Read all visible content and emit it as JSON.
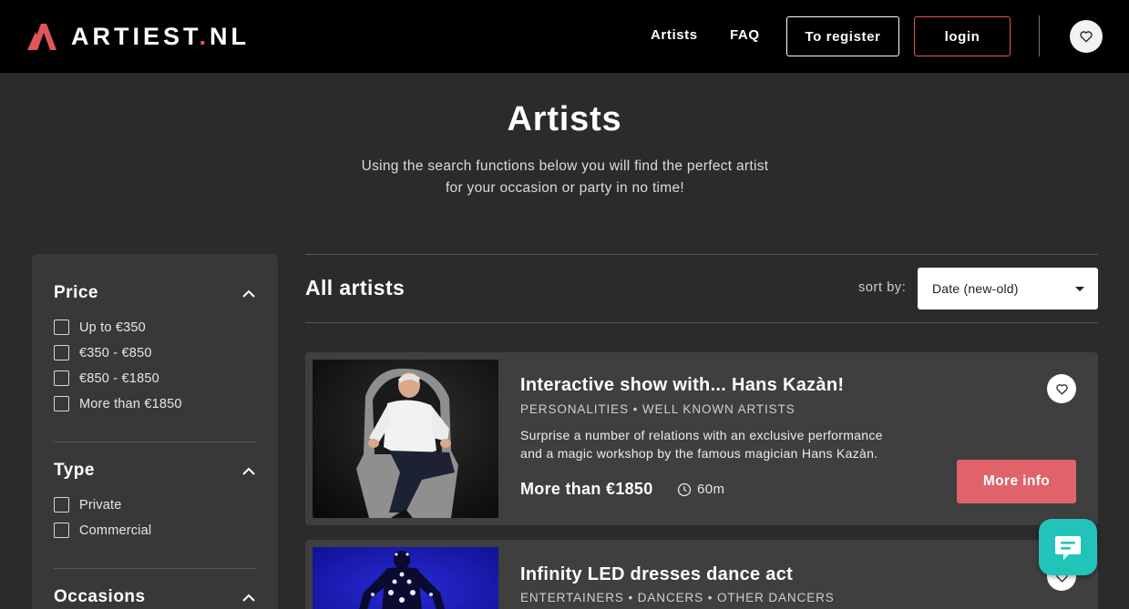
{
  "header": {
    "logo_text_main": "ARTIEST",
    "logo_text_dot": ".",
    "logo_text_tld": "NL",
    "nav": [
      {
        "label": "Artists"
      },
      {
        "label": "FAQ"
      }
    ],
    "register_label": "To register",
    "login_label": "login",
    "favorites_icon": "heart-icon"
  },
  "hero": {
    "title": "Artists",
    "subtitle_line1": "Using the search functions below you will find the perfect artist",
    "subtitle_line2": "for your occasion or party in no time!"
  },
  "filters": {
    "price": {
      "title": "Price",
      "options": [
        "Up to €350",
        "€350 - €850",
        "€850 - €1850",
        "More than €1850"
      ]
    },
    "type": {
      "title": "Type",
      "options": [
        "Private",
        "Commercial"
      ]
    },
    "occasions": {
      "title": "Occasions"
    }
  },
  "listing": {
    "heading": "All artists",
    "sort_label": "sort by:",
    "sort_value": "Date (new-old)"
  },
  "cards": [
    {
      "title": "Interactive show with... Hans Kazàn!",
      "categories": "PERSONALITIES • WELL KNOWN ARTISTS",
      "description_line1": "Surprise a number of relations with an exclusive performance",
      "description_line2": "and a magic workshop by the famous magician Hans Kazàn.",
      "price": "More than €1850",
      "duration": "60m",
      "more_label": "More info"
    },
    {
      "title": "Infinity LED dresses dance act",
      "categories": "ENTERTAINERS • DANCERS • OTHER DANCERS"
    }
  ],
  "colors": {
    "accent": "#e0636a",
    "header_bg": "#000000",
    "page_bg": "#2b2b2b",
    "panel_bg": "#383838",
    "card_bg": "#3f3f3f",
    "chat_bg": "#22c4b9"
  }
}
